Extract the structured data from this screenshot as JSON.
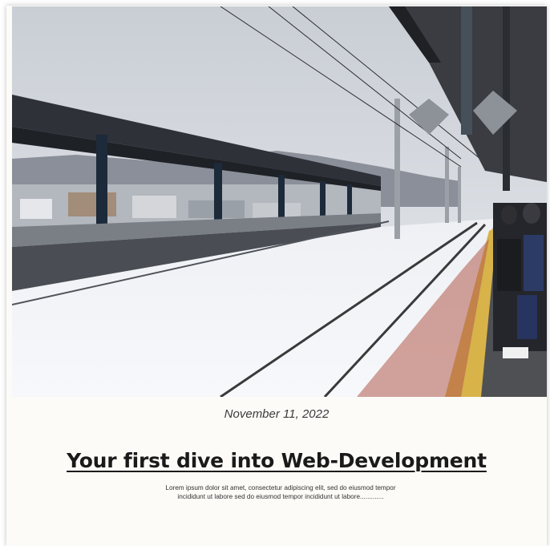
{
  "post": {
    "date": "November 11, 2022",
    "title": "Your first dive into Web-Development",
    "excerpt": "Lorem ipsum dolor sit amet, consectetur adipiscing elit, sed do eiusmod tempor incididunt ut labore sed do eiusmod tempor incididunt ut labore.............",
    "image_subject": "snowy-train-station-photo"
  },
  "colors": {
    "card_background": "#fcfbf8",
    "title_color": "#1a1a1a",
    "date_color": "#3b3b3b",
    "text_color": "#333333"
  }
}
